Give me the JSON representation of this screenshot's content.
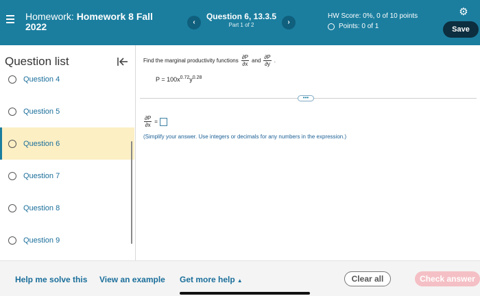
{
  "header": {
    "title_prefix": "Homework: ",
    "title_bold": "Homework 8 Fall",
    "title_line2": "2022",
    "question_title": "Question 6, 13.3.5",
    "question_part": "Part 1 of 2",
    "prev_icon": "‹",
    "next_icon": "›",
    "hw_score": "HW Score: 0%, 0 of 10 points",
    "points": "Points: 0 of 1",
    "save_label": "Save",
    "gear_icon": "⚙"
  },
  "sidebar": {
    "title": "Question list",
    "items": [
      {
        "label": "Question 4"
      },
      {
        "label": "Question 5"
      },
      {
        "label": "Question 6"
      },
      {
        "label": "Question 7"
      },
      {
        "label": "Question 8"
      },
      {
        "label": "Question 9"
      }
    ]
  },
  "question": {
    "prompt_start": "Find the marginal productivity functions",
    "frac1_num": "∂P",
    "frac1_den": "∂x",
    "and": "and",
    "frac2_num": "∂P",
    "frac2_den": "∂y",
    "period": ".",
    "formula_base": "P = 100x",
    "exp_x": "0.72",
    "y": "y",
    "exp_y": "0.28",
    "more_dots": "•••",
    "answer_num": "∂P",
    "answer_den": "∂x",
    "equals": "=",
    "hint": "(Simplify your answer. Use integers or decimals for any numbers in the expression.)"
  },
  "footer": {
    "help_solve": "Help me solve this",
    "view_example": "View an example",
    "get_help": "Get more help",
    "get_help_tri": "▲",
    "clear_all": "Clear all",
    "check_answer": "Check answer"
  }
}
